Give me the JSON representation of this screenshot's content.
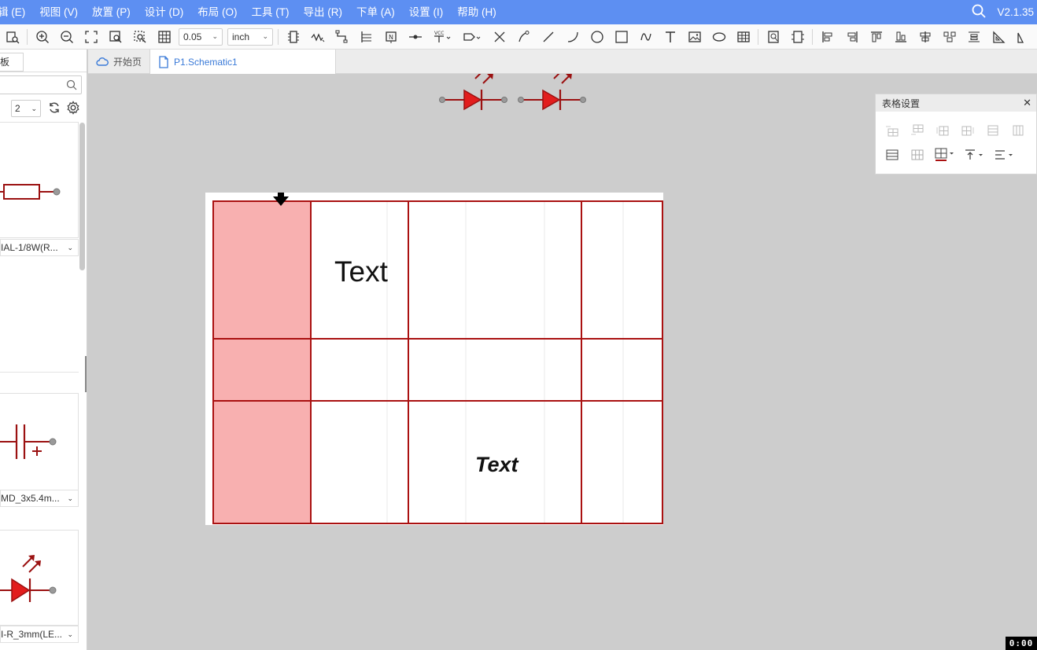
{
  "menubar": {
    "items": [
      "辑 (E)",
      "视图 (V)",
      "放置 (P)",
      "设计 (D)",
      "布局 (O)",
      "工具 (T)",
      "导出 (R)",
      "下单 (A)",
      "设置 (I)",
      "帮助 (H)"
    ],
    "version": "V2.1.35",
    "search_icon": "search-icon",
    "color": "#5d8ff2"
  },
  "toolbar": {
    "grid_size": "0.05",
    "unit": "inch"
  },
  "left_panel": {
    "tab_label": "板",
    "page_value": "2",
    "components": [
      {
        "name": "IAL-1/8W(R...",
        "symbol": "resistor"
      },
      {
        "name": "MD_3x5.4m...",
        "symbol": "capacitor"
      },
      {
        "name": "I-R_3mm(LE...",
        "symbol": "led"
      }
    ]
  },
  "doc_tabs": [
    {
      "label": "开始页",
      "icon": "cloud-icon"
    },
    {
      "label": "P1.Schematic1",
      "icon": "schematic-file-icon",
      "active": true
    }
  ],
  "canvas": {
    "table": {
      "cells": [
        {
          "row": 0,
          "col": 1,
          "text": "Text",
          "style": "normal"
        },
        {
          "row": 2,
          "col": 2,
          "text": "Text",
          "style": "bold-italic"
        }
      ],
      "selected_column": 0,
      "border_color": "#aa1111",
      "selected_fill": "#f8b0b0"
    },
    "leds": [
      "led-symbol",
      "led-symbol"
    ]
  },
  "table_panel": {
    "title": "表格设置",
    "close": "✕"
  },
  "timer": "0:00"
}
